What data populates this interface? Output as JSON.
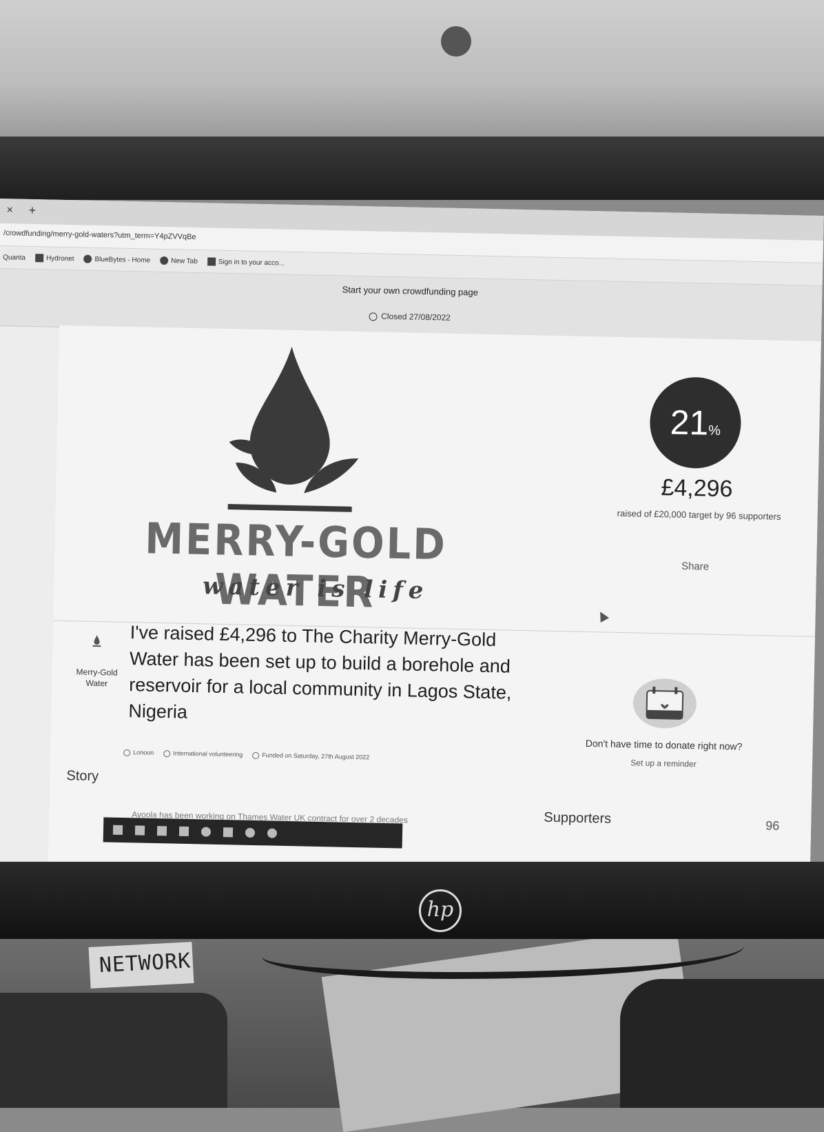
{
  "browser": {
    "tab_close": "×",
    "tab_new": "+",
    "url": "/crowdfunding/merry-gold-waters?utm_term=Y4pZVVqBe",
    "bookmarks": [
      {
        "label": "Quanta"
      },
      {
        "label": "Hydronet"
      },
      {
        "label": "BlueBytes - Home"
      },
      {
        "label": "New Tab"
      },
      {
        "label": "Sign in to your acco..."
      }
    ]
  },
  "banner": {
    "start_link": "Start your own crowdfunding page",
    "closed": "Closed 27/08/2022"
  },
  "logo": {
    "title": "MERRY-GOLD WATER",
    "tagline": "water is life"
  },
  "progress": {
    "percent": "21",
    "percent_sign": "%",
    "raised": "£4,296",
    "raised_sub": "raised of £20,000 target by 96 supporters",
    "share": "Share"
  },
  "campaign": {
    "org_name": "Merry-Gold Water",
    "headline": "I've raised £4,296 to The Charity Merry-Gold Water has been set up to build a borehole and reservoir for a local community in Lagos State, Nigeria",
    "meta": [
      "Lonoon",
      "International volunteering",
      "Funded on Saturday, 27th August 2022"
    ],
    "story_label": "Story",
    "story_excerpt": "Ayoola has been working on Thames Water UK contract for over 2 decades"
  },
  "reminder": {
    "question": "Don't have time to donate right now?",
    "link": "Set up a reminder"
  },
  "supporters": {
    "label": "Supporters",
    "count": "96"
  },
  "photo": {
    "monitor_logo": "hp",
    "desk_label": "NETWORK"
  }
}
